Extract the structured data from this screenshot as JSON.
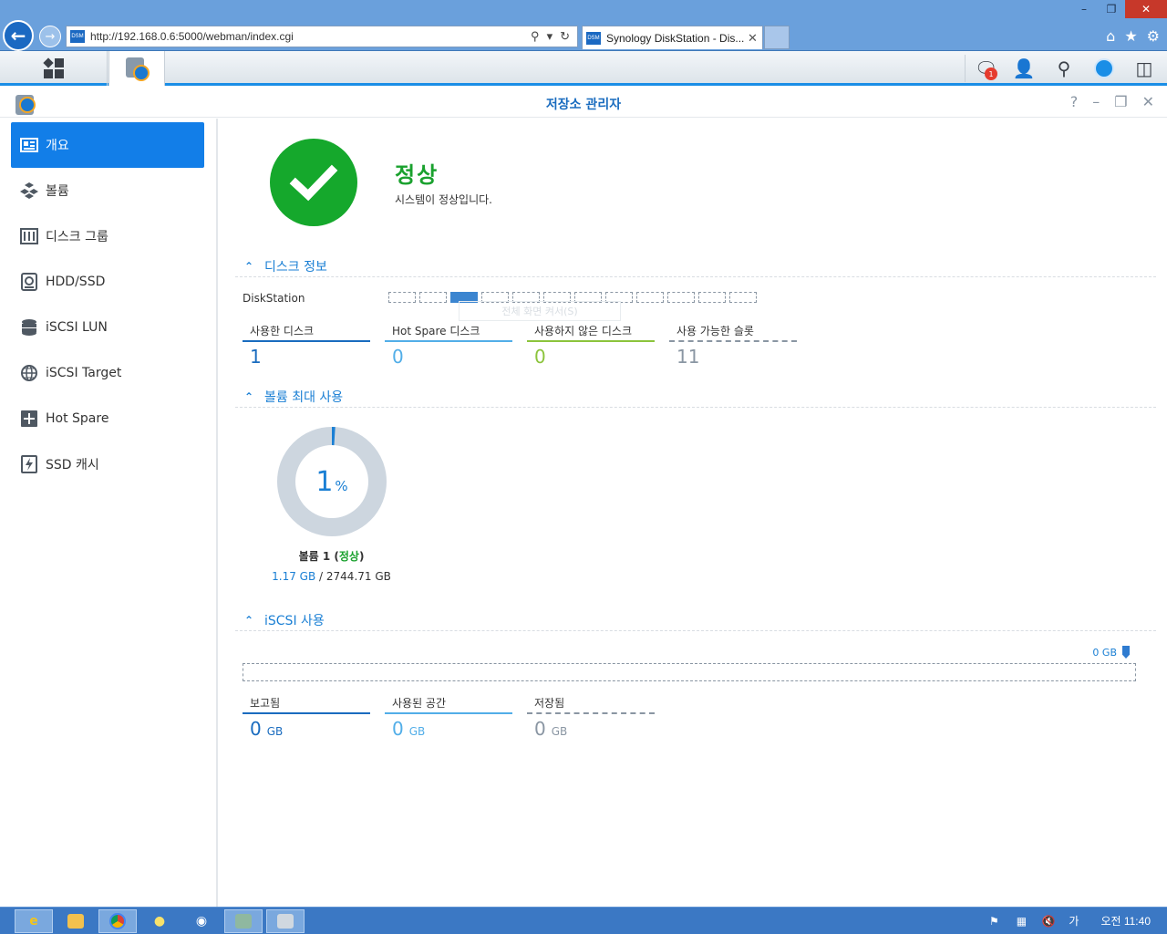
{
  "browser": {
    "url": "http://192.168.0.6:5000/webman/index.cgi",
    "tab_title": "Synology DiskStation - Dis...",
    "favicon_text": "DSM"
  },
  "window": {
    "title": "저장소 관리자"
  },
  "dsm_tray": {
    "notification_count": "1"
  },
  "sidebar": {
    "items": [
      {
        "label": "개요",
        "icon": "overview-icon"
      },
      {
        "label": "볼륨",
        "icon": "volume-icon"
      },
      {
        "label": "디스크 그룹",
        "icon": "disk-group-icon"
      },
      {
        "label": "HDD/SSD",
        "icon": "hdd-icon"
      },
      {
        "label": "iSCSI LUN",
        "icon": "lun-icon"
      },
      {
        "label": "iSCSI Target",
        "icon": "target-icon"
      },
      {
        "label": "Hot Spare",
        "icon": "hot-spare-icon"
      },
      {
        "label": "SSD 캐시",
        "icon": "ssd-cache-icon"
      }
    ]
  },
  "status": {
    "title": "정상",
    "description": "시스템이 정상입니다."
  },
  "disk_info": {
    "header": "디스크 정보",
    "station_label": "DiskStation",
    "slot_count": 12,
    "used_slot_index": 2,
    "tooltip": "전체 화면 켜서(S)",
    "stats": [
      {
        "label": "사용한 디스크",
        "value": "1",
        "color": "#1a6cbf"
      },
      {
        "label": "Hot Spare 디스크",
        "value": "0",
        "color": "#52aee8"
      },
      {
        "label": "사용하지 않은 디스크",
        "value": "0",
        "color": "#8cc43c"
      },
      {
        "label": "사용 가능한 슬롯",
        "value": "11",
        "color": "#8a96a3"
      }
    ]
  },
  "volume_usage": {
    "header": "볼륨 최대 사용",
    "percent": "1",
    "percent_sign": "%",
    "usage_fraction": 0.01,
    "volume_name": "볼륨 1",
    "volume_state": "정상",
    "used": "1.17 GB",
    "separator": "/",
    "total": "2744.71 GB"
  },
  "iscsi": {
    "header": "iSCSI 사용",
    "marker": "0 GB",
    "stats": [
      {
        "label": "보고됨",
        "value": "0",
        "unit": "GB",
        "color": "#1a6cbf"
      },
      {
        "label": "사용된 공간",
        "value": "0",
        "unit": "GB",
        "color": "#52aee8"
      },
      {
        "label": "저장됨",
        "value": "0",
        "unit": "GB",
        "color": "#8a96a3"
      }
    ]
  },
  "win_tray": {
    "ime": "가",
    "clock": "오전 11:40"
  },
  "colors": {
    "accent": "#127ee8",
    "success": "#15a82c",
    "donut_track": "#cdd6df"
  }
}
